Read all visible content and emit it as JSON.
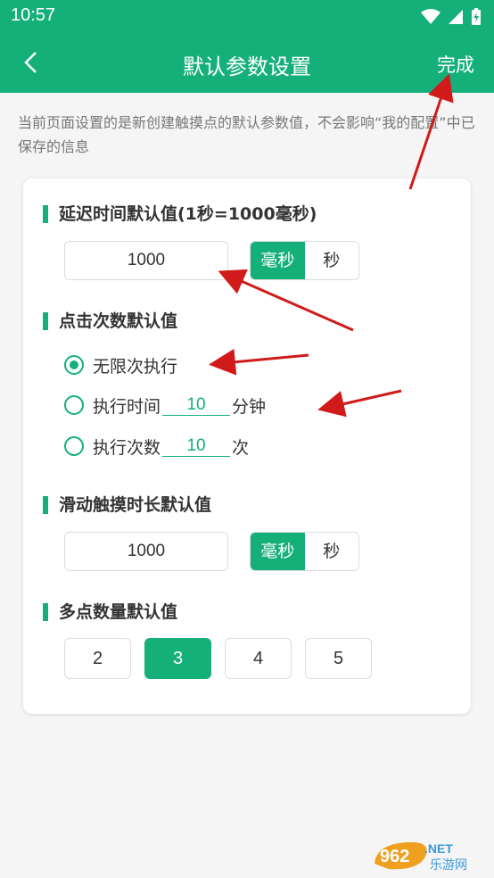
{
  "status": {
    "time": "10:57"
  },
  "appbar": {
    "title": "默认参数设置",
    "done_label": "完成"
  },
  "hint": "当前页面设置的是新创建触摸点的默认参数值，不会影响“我的配置”中已保存的信息",
  "delay": {
    "title": "延迟时间默认值(1秒=1000毫秒)",
    "value": "1000",
    "unit_ms": "毫秒",
    "unit_s": "秒",
    "selected": "ms"
  },
  "clicks": {
    "title": "点击次数默认值",
    "options": [
      {
        "label": "无限次执行",
        "selected": true
      },
      {
        "label_before": "执行时间",
        "value": "10",
        "label_after": "分钟",
        "selected": false
      },
      {
        "label_before": "执行次数",
        "value": "10",
        "label_after": "次",
        "selected": false
      }
    ]
  },
  "swipe": {
    "title": "滑动触摸时长默认值",
    "value": "1000",
    "unit_ms": "毫秒",
    "unit_s": "秒",
    "selected": "ms"
  },
  "multi": {
    "title": "多点数量默认值",
    "options": [
      "2",
      "3",
      "4",
      "5"
    ],
    "selected": "3"
  },
  "watermark": {
    "text1": "962",
    "text2": ".NET",
    "text3": "乐游网"
  },
  "colors": {
    "primary": "#15b07a",
    "arrow": "#d11a1a"
  }
}
